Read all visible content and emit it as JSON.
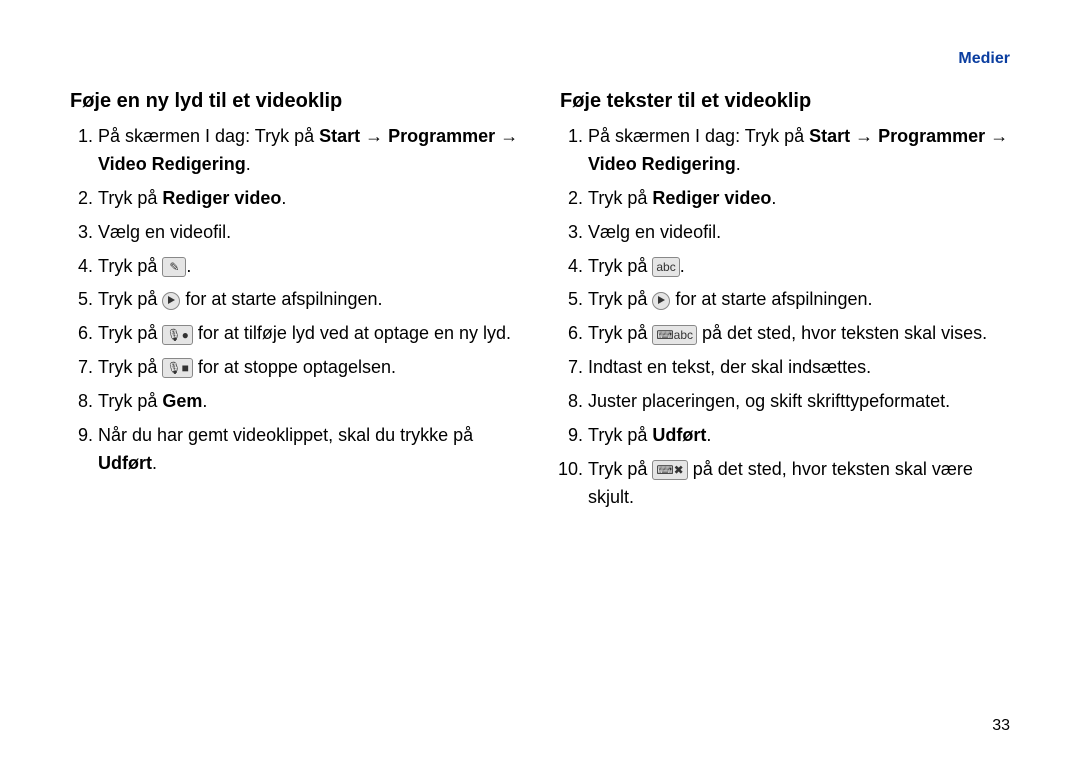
{
  "section_header": "Medier",
  "page_number": "33",
  "left": {
    "heading": "Føje en ny lyd til et videoklip",
    "steps": {
      "s1_pre": "På skærmen I dag: Tryk på ",
      "s1_start": "Start",
      "s1_arrow1": "→",
      "s1_prog": "Programmer",
      "s1_arrow2": "→",
      "s1_vr": "Video Redigering",
      "s1_end": ".",
      "s2_pre": "Tryk på ",
      "s2_bold": "Rediger video",
      "s2_end": ".",
      "s3": "Vælg en videofil.",
      "s4_pre": "Tryk på ",
      "s4_icon": "✎",
      "s4_end": ".",
      "s5_pre": "Tryk på ",
      "s5_end": " for at starte afspilningen.",
      "s6_pre": "Tryk på ",
      "s6_icon": "🎙●",
      "s6_end": " for at tilføje lyd ved at optage en ny lyd.",
      "s7_pre": "Tryk på ",
      "s7_icon": "🎙■",
      "s7_end": " for at stoppe optagelsen.",
      "s8_pre": "Tryk på ",
      "s8_bold": "Gem",
      "s8_end": ".",
      "s9_pre": "Når du har gemt videoklippet, skal du trykke på ",
      "s9_bold": "Udført",
      "s9_end": "."
    }
  },
  "right": {
    "heading": "Føje tekster til et videoklip",
    "steps": {
      "s1_pre": "På skærmen I dag: Tryk på ",
      "s1_start": "Start",
      "s1_arrow1": "→",
      "s1_prog": "Programmer",
      "s1_arrow2": "→",
      "s1_vr": "Video Redigering",
      "s1_end": ".",
      "s2_pre": "Tryk på ",
      "s2_bold": "Rediger video",
      "s2_end": ".",
      "s3": "Vælg en videofil.",
      "s4_pre": "Tryk på ",
      "s4_icon": "abc",
      "s4_end": ".",
      "s5_pre": "Tryk på ",
      "s5_end": " for at starte afspilningen.",
      "s6_pre": "Tryk på ",
      "s6_icon": "⌨abc",
      "s6_end": " på det sted, hvor teksten skal vises.",
      "s7": "Indtast en tekst, der skal indsættes.",
      "s8": "Juster placeringen, og skift skrifttypeformatet.",
      "s9_pre": "Tryk på ",
      "s9_bold": "Udført",
      "s9_end": ".",
      "s10_pre": "Tryk på ",
      "s10_icon": "⌨✖",
      "s10_end": " på det sted, hvor teksten skal være skjult."
    }
  }
}
